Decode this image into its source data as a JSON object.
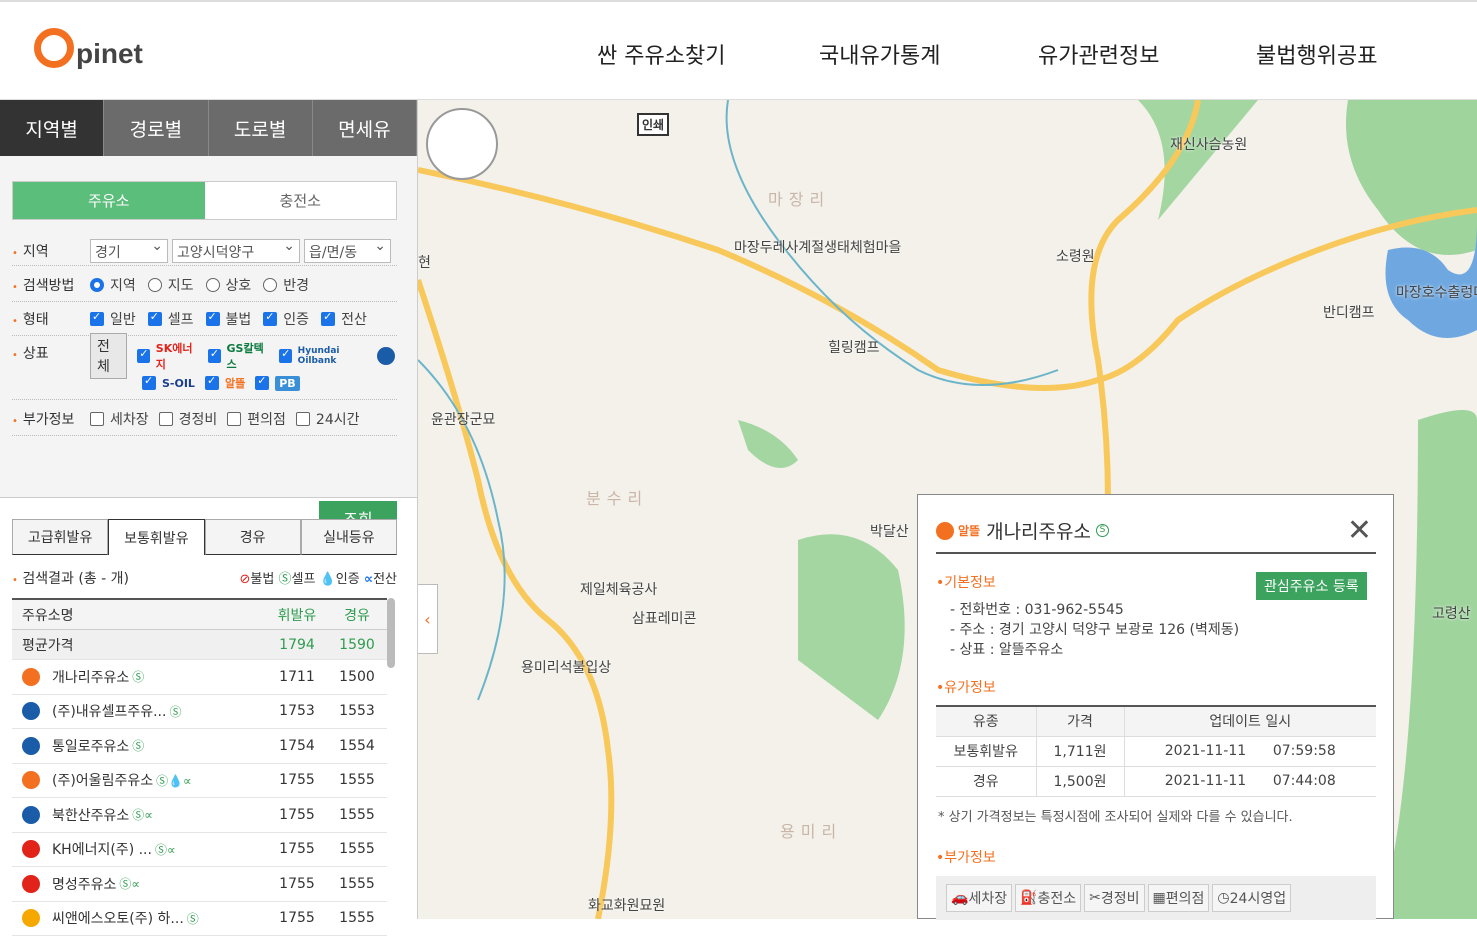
{
  "header": {
    "logo_o": "O",
    "logo_rest": "pinet",
    "nav": [
      "싼 주유소찾기",
      "국내유가통계",
      "유가관련정보",
      "불법행위공표"
    ]
  },
  "tabs": [
    "지역별",
    "경로별",
    "도로별",
    "면세유"
  ],
  "segment": [
    "주유소",
    "충전소"
  ],
  "filters": {
    "region_label": "지역",
    "region": [
      "경기",
      "고양시덕양구",
      "읍/면/동"
    ],
    "method_label": "검색방법",
    "methods": [
      "지역",
      "지도",
      "상호",
      "반경"
    ],
    "type_label": "형태",
    "types": [
      "일반",
      "셀프",
      "불법",
      "인증",
      "전산"
    ],
    "brand_label": "상표",
    "brand_all": "전체",
    "brands": [
      "SK에너지",
      "GS칼텍스",
      "Hyundai Oilbank",
      "S-OIL",
      "알뜰",
      "PB"
    ],
    "extra_label": "부가정보",
    "extras": [
      "세차장",
      "경정비",
      "편의점",
      "24시간"
    ],
    "search_button": "조회"
  },
  "fuel_tabs": [
    "고급휘발유",
    "보통휘발유",
    "경유",
    "실내등유"
  ],
  "result": {
    "label": "검색결과 (총 - 개)",
    "legend": [
      "불법",
      "셀프",
      "인증",
      "전산"
    ]
  },
  "table": {
    "headers": [
      "주유소명",
      "휘발유",
      "경유"
    ],
    "average": {
      "name": "평균가격",
      "gas": "1794",
      "diesel": "1590"
    },
    "rows": [
      {
        "name": "개나리주유소",
        "gas": "1711",
        "diesel": "1500",
        "brand_color": "#f37021",
        "brand_icon": "altteul-icon",
        "badges": "Ⓢ"
      },
      {
        "name": "(주)내유셀프주유...",
        "gas": "1753",
        "diesel": "1553",
        "brand_color": "#1a5ca8",
        "brand_icon": "hyundai-icon",
        "badges": "Ⓢ"
      },
      {
        "name": "통일로주유소",
        "gas": "1754",
        "diesel": "1554",
        "brand_color": "#1a5ca8",
        "brand_icon": "hyundai-icon",
        "badges": "Ⓢ"
      },
      {
        "name": "(주)어울림주유소",
        "gas": "1755",
        "diesel": "1555",
        "brand_color": "#f37021",
        "brand_icon": "altteul-icon",
        "badges": "Ⓢ💧∝"
      },
      {
        "name": "북한산주유소",
        "gas": "1755",
        "diesel": "1555",
        "brand_color": "#1a5ca8",
        "brand_icon": "hyundai-icon",
        "badges": "Ⓢ∝"
      },
      {
        "name": "KH에너지(주) ...",
        "gas": "1755",
        "diesel": "1555",
        "brand_color": "#e2231a",
        "brand_icon": "sk-icon",
        "badges": "Ⓢ∝"
      },
      {
        "name": "명성주유소",
        "gas": "1755",
        "diesel": "1555",
        "brand_color": "#e2231a",
        "brand_icon": "sk-icon",
        "badges": "Ⓢ∝"
      },
      {
        "name": "씨앤에스오토(주) 하...",
        "gas": "1755",
        "diesel": "1555",
        "brand_color": "#f5a800",
        "brand_icon": "soil-icon",
        "badges": "Ⓢ"
      }
    ]
  },
  "map": {
    "print_button": "인쇄",
    "labels": [
      "재신사슴농원",
      "마장리",
      "마장두레사계절생태체험마을",
      "소령원",
      "반디캠프",
      "마장호수출렁다",
      "힐링캠프",
      "윤관장군묘",
      "분수리",
      "박달산",
      "제일체육공사",
      "삼표레미콘",
      "용미리석불입상",
      "용미리",
      "고령산",
      "화교화원묘원",
      "현"
    ]
  },
  "popup": {
    "title": "개나리주유소",
    "brand": "알뜰",
    "sec_basic": "기본정보",
    "fav_button": "관심주유소 등록",
    "phone": "- 전화번호 : 031-962-5545",
    "addr": "- 주소 : 경기 고양시 덕양구 보광로 126 (벽제동)",
    "brand_line": "- 상표 : 알뜰주유소",
    "sec_price": "유가정보",
    "price_headers": [
      "유종",
      "가격",
      "업데이트 일시"
    ],
    "prices": [
      {
        "fuel": "보통휘발유",
        "price": "1,711원",
        "date": "2021-11-11",
        "time": "07:59:58"
      },
      {
        "fuel": "경유",
        "price": "1,500원",
        "date": "2021-11-11",
        "time": "07:44:08"
      }
    ],
    "note": "* 상기 가격정보는 특정시점에 조사되어 실제와 다를 수 있습니다.",
    "sec_extra": "부가정보",
    "extras": [
      "세차장",
      "충전소",
      "경정비",
      "편의점",
      "24시영업"
    ]
  }
}
